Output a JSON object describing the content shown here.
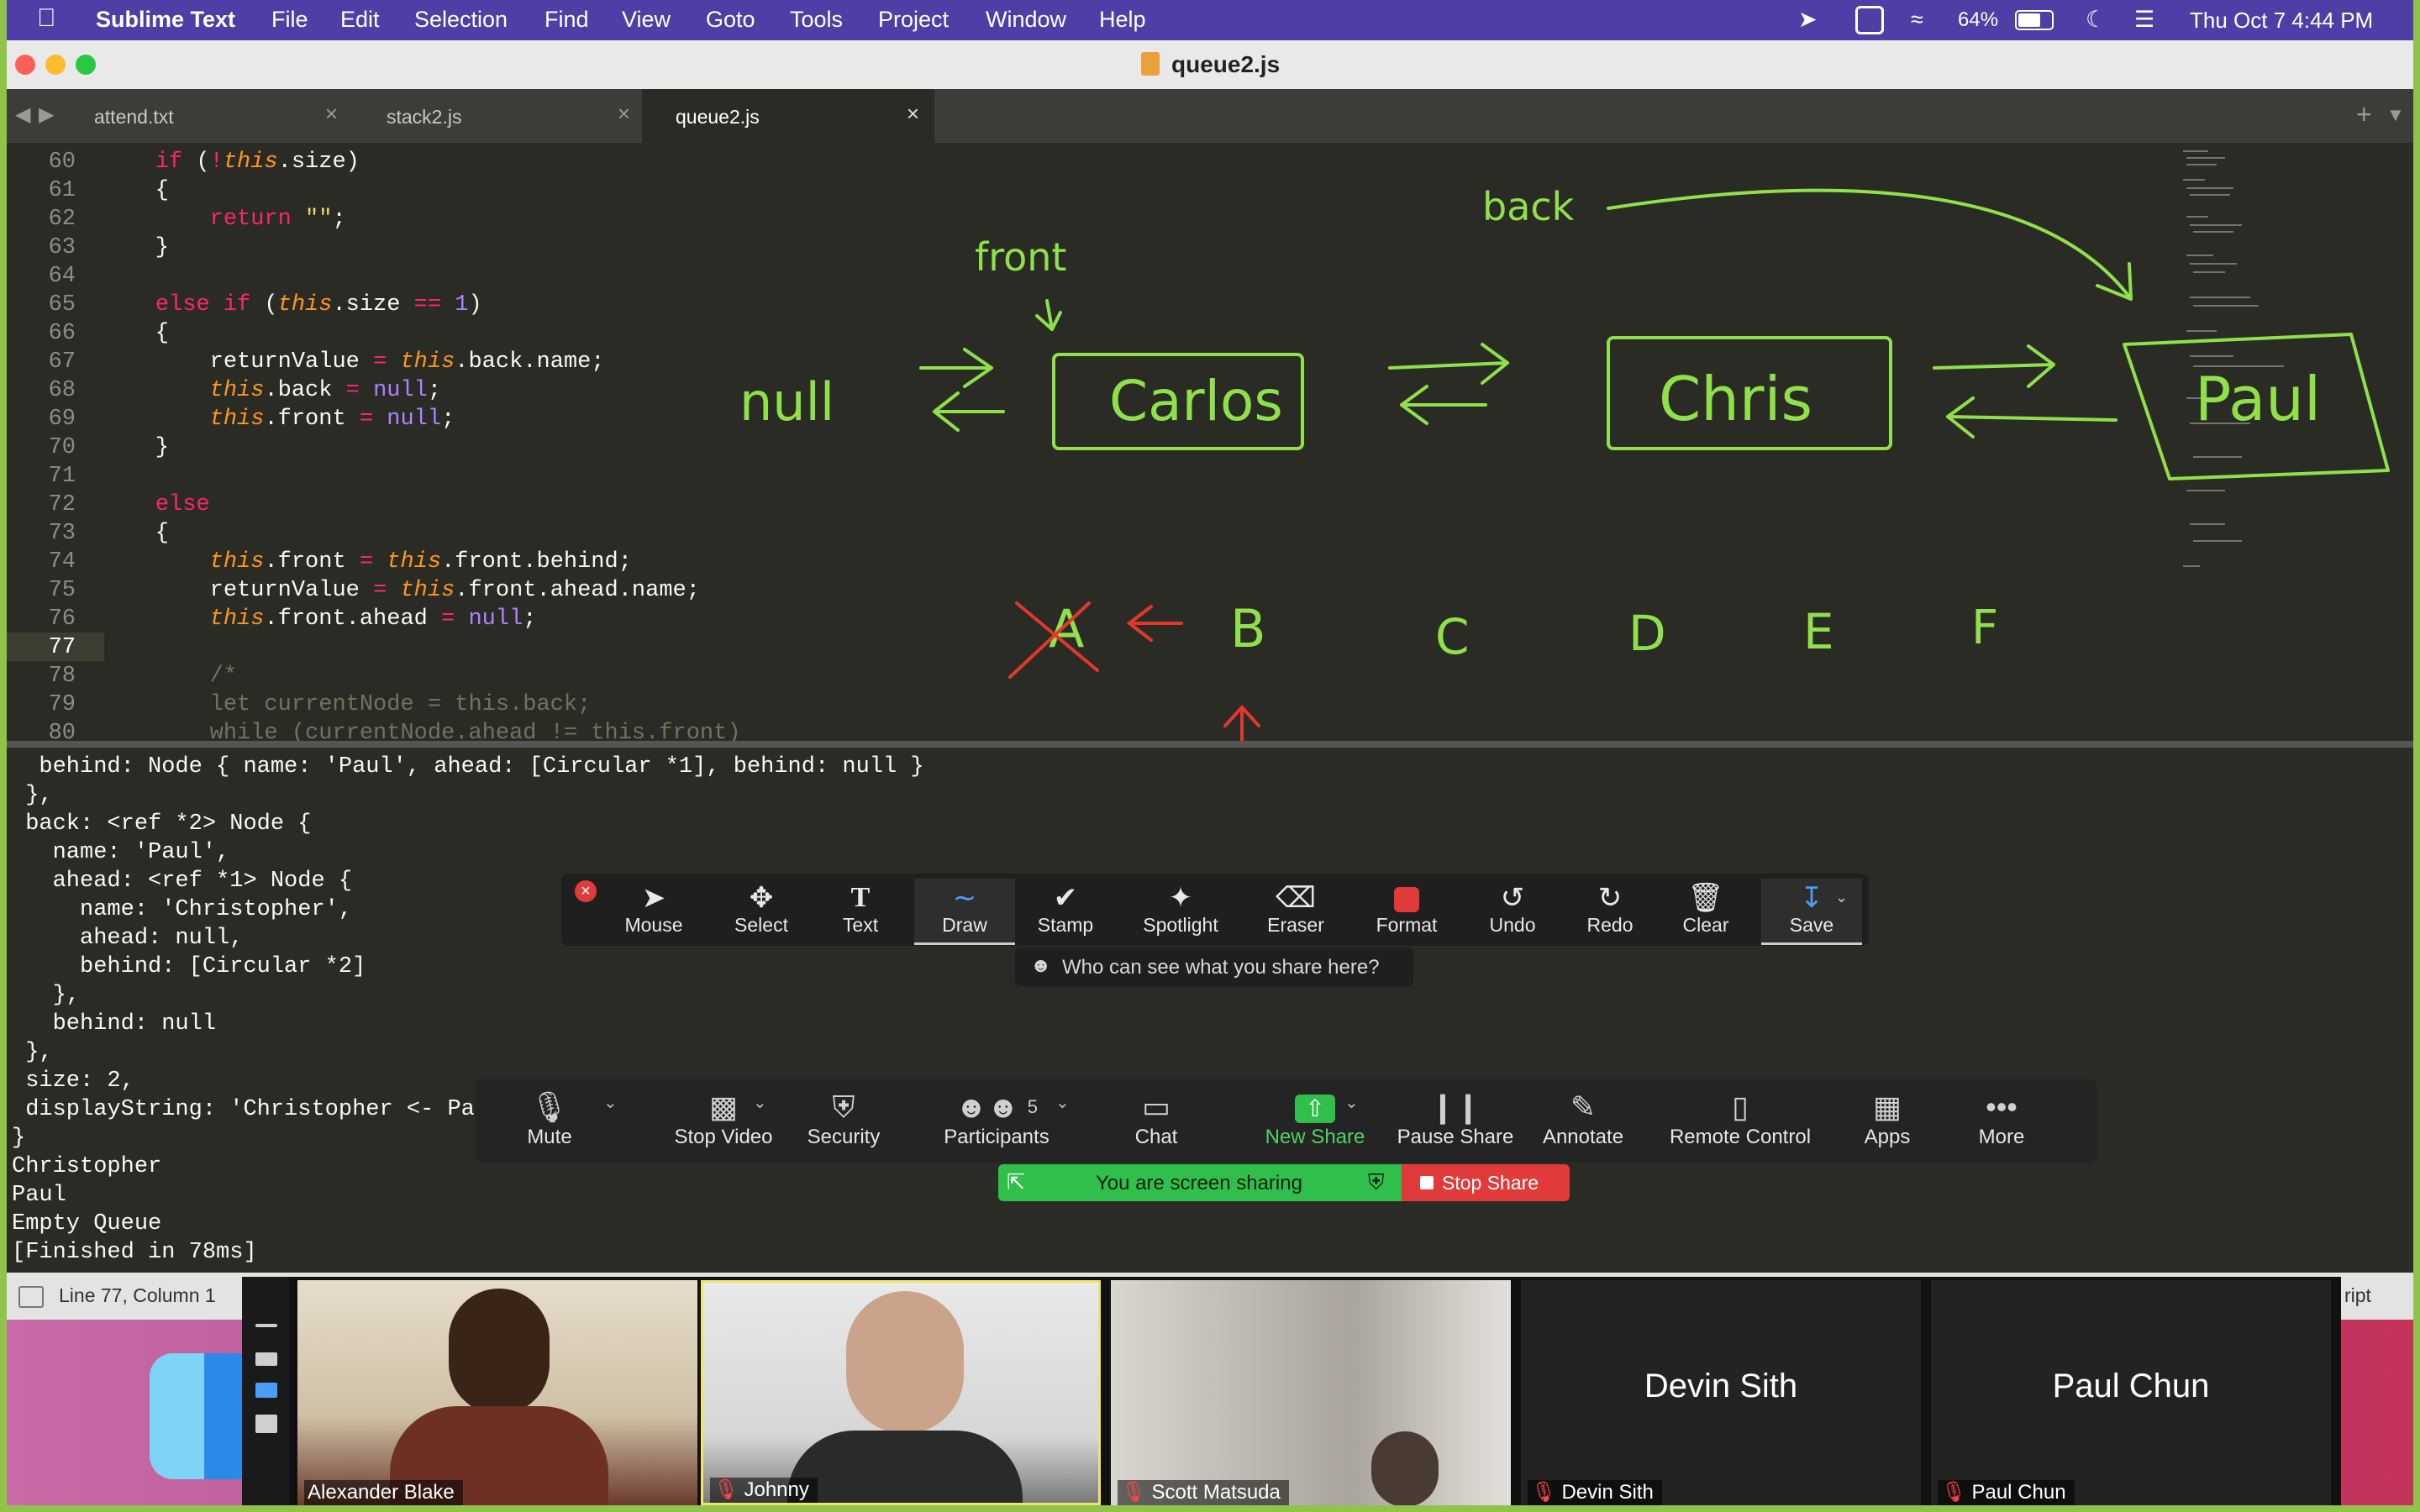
{
  "menubar": {
    "apple": "",
    "app": "Sublime Text",
    "items": [
      "File",
      "Edit",
      "Selection",
      "Find",
      "View",
      "Goto",
      "Tools",
      "Project",
      "Window",
      "Help"
    ],
    "battery": "64%",
    "datetime": "Thu Oct 7  4:44 PM"
  },
  "window": {
    "title": "queue2.js"
  },
  "tabs": [
    {
      "label": "attend.txt"
    },
    {
      "label": "stack2.js"
    },
    {
      "label": "queue2.js"
    }
  ],
  "editor": {
    "lines": [
      "60",
      "61",
      "62",
      "63",
      "64",
      "65",
      "66",
      "67",
      "68",
      "69",
      "70",
      "71",
      "72",
      "73",
      "74",
      "75",
      "76",
      "77",
      "78",
      "79",
      "80"
    ],
    "current_line": "77"
  },
  "console": {
    "lines": [
      "  behind: Node { name: 'Paul', ahead: [Circular *1], behind: null }",
      " },",
      " back: <ref *2> Node {",
      "   name: 'Paul',",
      "   ahead: <ref *1> Node {",
      "     name: 'Christopher',",
      "     ahead: null,",
      "     behind: [Circular *2]",
      "   },",
      "   behind: null",
      " },",
      " size: 2,",
      " displayString: 'Christopher <- Pa",
      "}",
      "Christopher",
      "Paul",
      "Empty Queue",
      "[Finished in 78ms]"
    ]
  },
  "drawing": {
    "labels": {
      "front": "front",
      "back": "back",
      "null": "null",
      "carlos": "Carlos",
      "chris": "Chris",
      "paul": "Paul",
      "a": "A",
      "b": "B",
      "c": "C",
      "d": "D",
      "e": "E",
      "f": "F"
    }
  },
  "annotate": {
    "tools": [
      "Mouse",
      "Select",
      "Text",
      "Draw",
      "Stamp",
      "Spotlight",
      "Eraser",
      "Format",
      "Undo",
      "Redo",
      "Clear",
      "Save"
    ],
    "active": "Draw",
    "who_can_see": "Who can see what you share here?"
  },
  "zoom": {
    "buttons": [
      "Mute",
      "Stop Video",
      "Security",
      "Participants",
      "Chat",
      "New Share",
      "Pause Share",
      "Annotate",
      "Remote Control",
      "Apps",
      "More"
    ],
    "participant_count": "5",
    "sharing_text": "You are screen sharing",
    "stop_share": "Stop Share"
  },
  "status": {
    "position": "Line 77, Column 1",
    "syntax_fragment": "ript"
  },
  "participants": [
    {
      "name": "Alexander Blake"
    },
    {
      "name": "Johnny"
    },
    {
      "name": "Scott Matsuda"
    },
    {
      "name": "Devin Sith"
    },
    {
      "name": "Paul Chun"
    }
  ],
  "colors": {
    "annotation_green": "#8fe14a",
    "annotation_red": "#e0392b",
    "menubar": "#4e3fa6",
    "share_green": "#2fbf4a",
    "stop_red": "#e03a3a"
  }
}
